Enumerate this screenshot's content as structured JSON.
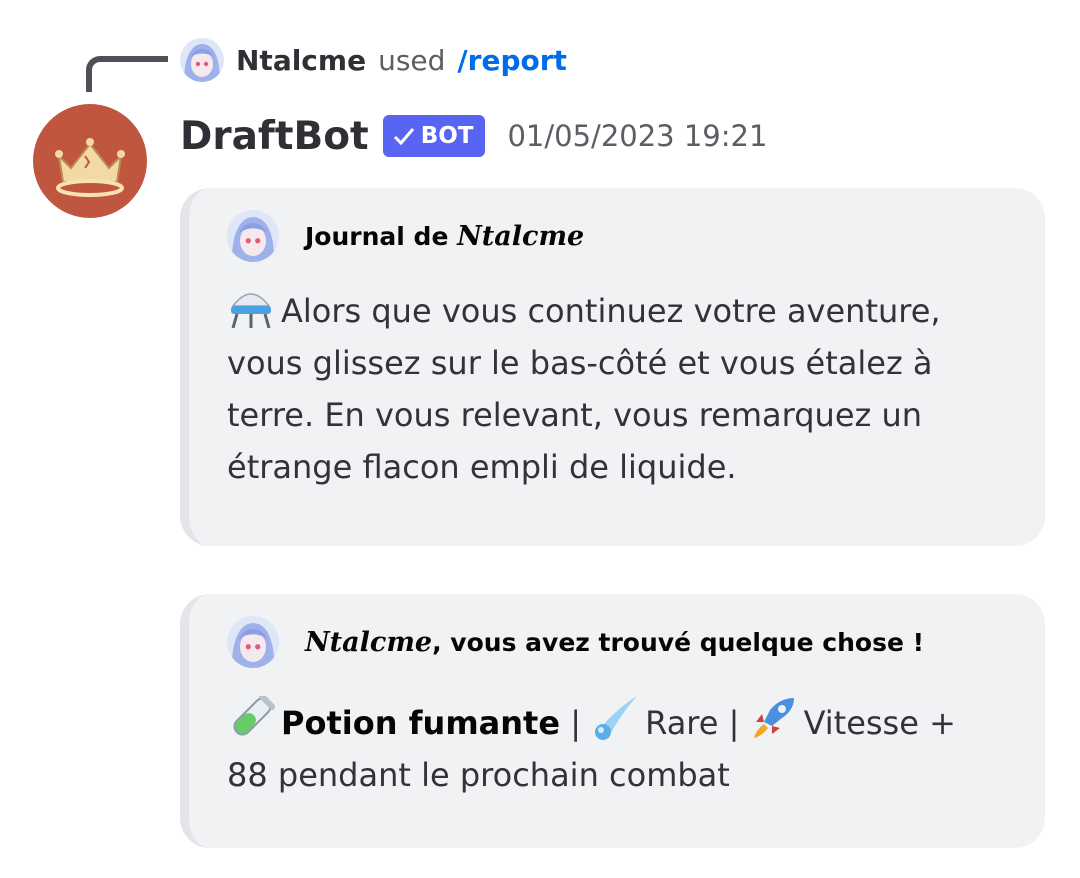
{
  "reply": {
    "user_name": "Ntalcme",
    "used_text": "used",
    "command": "/report"
  },
  "message": {
    "author_name": "DraftBot",
    "bot_tag": "BOT",
    "timestamp": "01/05/2023 19:21"
  },
  "embeds": [
    {
      "author_prefix": "Journal de ",
      "author_name": "Ntalcme",
      "description_emoji": "alembic-icon",
      "description": "Alors que vous continuez votre aventure, vous glissez sur le bas-côté et vous étalez à terre. En vous relevant, vous remarquez un étrange flacon empli de liquide."
    },
    {
      "author_name": "Ntalcme",
      "author_suffix": ", vous avez trouvé quelque chose !",
      "item_emoji": "test-tube-icon",
      "item_name": "Potion fumante",
      "separator_1": " | ",
      "rarity_emoji": "comet-icon",
      "rarity": "Rare",
      "separator_2": " | ",
      "effect_emoji": "rocket-icon",
      "effect": "Vitesse + 88 pendant le prochain combat"
    }
  ],
  "colors": {
    "bot_tag": "#5865f2",
    "command_link": "#006ce7",
    "bot_avatar_bg": "#c0563f",
    "embed_bg": "#f1f2f4"
  }
}
